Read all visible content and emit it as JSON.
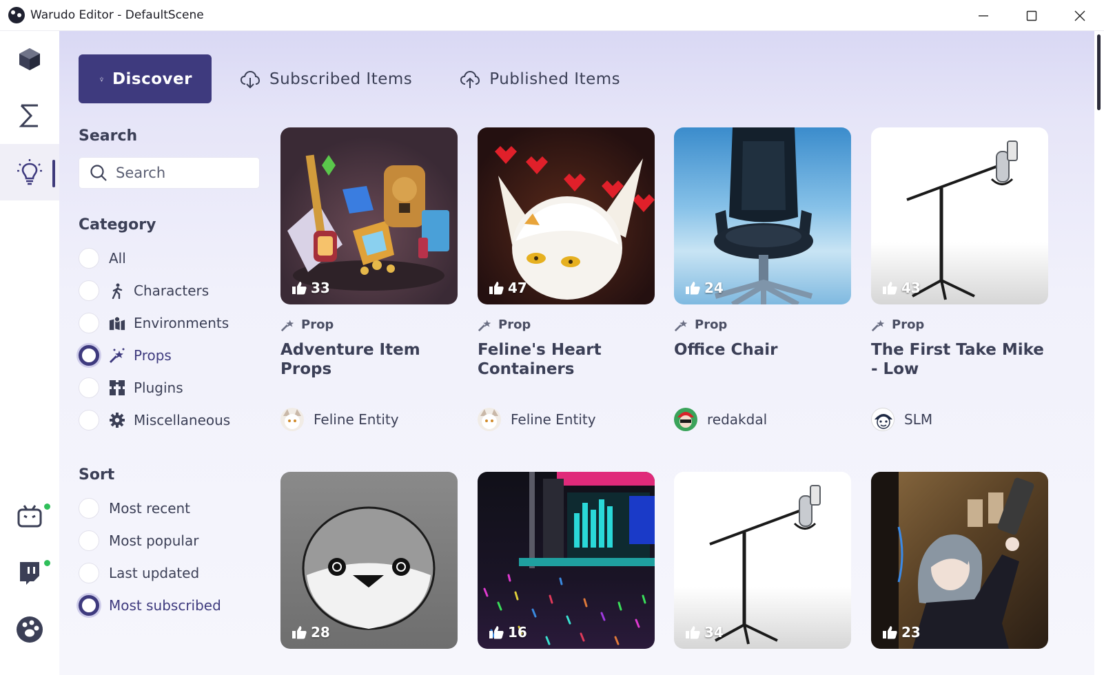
{
  "window": {
    "title": "Warudo Editor - DefaultScene"
  },
  "tabs": [
    {
      "label": "Discover",
      "icon": "lightbulb-icon"
    },
    {
      "label": "Subscribed Items",
      "icon": "cloud-download-icon"
    },
    {
      "label": "Published Items",
      "icon": "cloud-upload-icon"
    }
  ],
  "search": {
    "title": "Search",
    "placeholder": "Search"
  },
  "category": {
    "title": "Category",
    "options": [
      "All",
      "Characters",
      "Environments",
      "Props",
      "Plugins",
      "Miscellaneous"
    ],
    "selected": "Props"
  },
  "sort": {
    "title": "Sort",
    "options": [
      "Most recent",
      "Most popular",
      "Last updated",
      "Most subscribed"
    ],
    "selected": "Most subscribed"
  },
  "items": [
    {
      "title": "Adventure Item Props",
      "type": "Prop",
      "likes": "33",
      "author": "Feline Entity"
    },
    {
      "title": "Feline's Heart Containers",
      "type": "Prop",
      "likes": "47",
      "author": "Feline Entity"
    },
    {
      "title": "Office Chair",
      "type": "Prop",
      "likes": "24",
      "author": "redakdal"
    },
    {
      "title": "The First Take Mike - Low",
      "type": "Prop",
      "likes": "43",
      "author": "SLM"
    },
    {
      "likes": "28"
    },
    {
      "likes": "16"
    },
    {
      "likes": "34"
    },
    {
      "likes": "23"
    }
  ],
  "colors": {
    "accent": "#3e3a7e",
    "online": "#2fbf5a"
  }
}
